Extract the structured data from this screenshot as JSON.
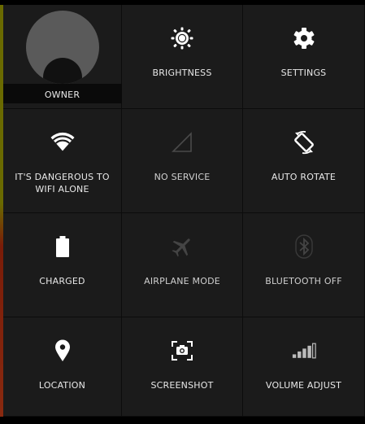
{
  "tiles": [
    {
      "label": "OWNER",
      "icon": "avatar"
    },
    {
      "label": "BRIGHTNESS",
      "icon": "brightness-icon"
    },
    {
      "label": "SETTINGS",
      "icon": "gear-icon"
    },
    {
      "label": "IT'S DANGEROUS TO WIFI ALONE",
      "icon": "wifi-icon"
    },
    {
      "label": "NO SERVICE",
      "icon": "no-signal-icon"
    },
    {
      "label": "AUTO ROTATE",
      "icon": "auto-rotate-icon"
    },
    {
      "label": "CHARGED",
      "icon": "battery-icon"
    },
    {
      "label": "AIRPLANE MODE",
      "icon": "airplane-icon"
    },
    {
      "label": "BLUETOOTH OFF",
      "icon": "bluetooth-icon"
    },
    {
      "label": "LOCATION",
      "icon": "location-pin-icon"
    },
    {
      "label": "SCREENSHOT",
      "icon": "screenshot-icon"
    },
    {
      "label": "VOLUME ADJUST",
      "icon": "volume-bars-icon"
    }
  ],
  "colors": {
    "tile_bg": "#1b1b1b",
    "icon_active": "#ffffff",
    "icon_inactive": "#444444",
    "label": "#e8e8e8"
  }
}
